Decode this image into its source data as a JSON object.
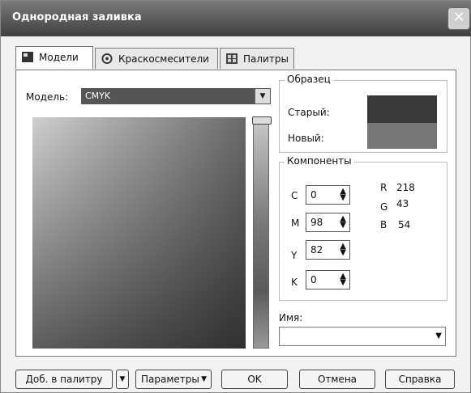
{
  "window": {
    "title": "Однородная заливка"
  },
  "tabs": [
    {
      "label": "Модели"
    },
    {
      "label": "Краскосмесители"
    },
    {
      "label": "Палитры"
    }
  ],
  "model": {
    "label": "Модель:",
    "value": "CMYK"
  },
  "sample": {
    "title": "Образец",
    "old_label": "Старый:",
    "new_label": "Новый:"
  },
  "components": {
    "title": "Компоненты",
    "cmyk": [
      {
        "label": "C",
        "value": "0"
      },
      {
        "label": "M",
        "value": "98"
      },
      {
        "label": "Y",
        "value": "82"
      },
      {
        "label": "K",
        "value": "0"
      }
    ],
    "rgb": [
      {
        "label": "R",
        "value": "218"
      },
      {
        "label": "G",
        "value": "43"
      },
      {
        "label": "B",
        "value": "54"
      }
    ]
  },
  "name": {
    "label": "Имя:",
    "value": ""
  },
  "buttons": {
    "add_to_palette": "Доб. в палитру",
    "parameters": "Параметры",
    "ok": "OK",
    "cancel": "Отмена",
    "help": "Справка"
  }
}
